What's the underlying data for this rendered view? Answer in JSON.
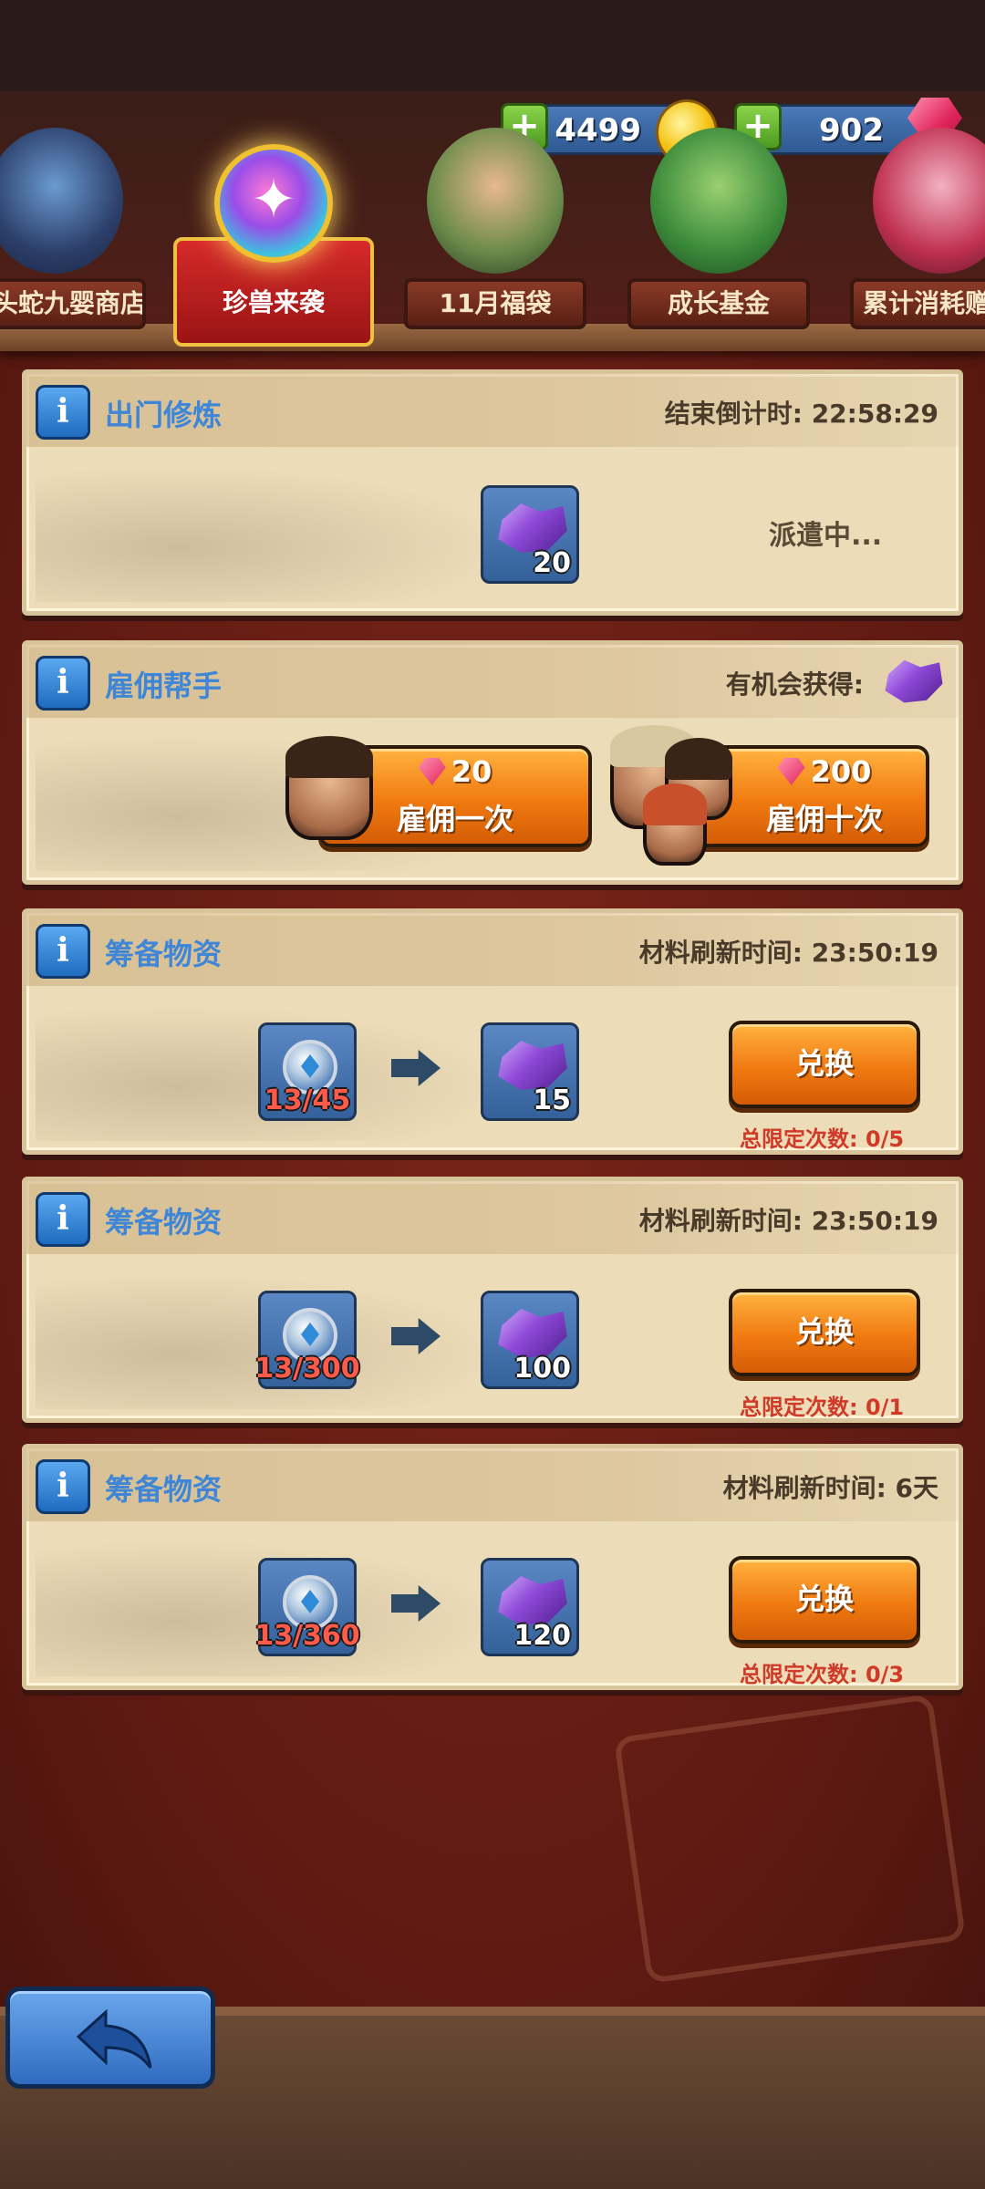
{
  "currency": {
    "gold": "4499",
    "gems": "902"
  },
  "tabs": [
    {
      "label": "九头蛇九婴商店"
    },
    {
      "label": "珍兽来袭"
    },
    {
      "label": "11月福袋"
    },
    {
      "label": "成长基金"
    },
    {
      "label": "累计消耗赠送"
    }
  ],
  "panels": {
    "dispatch": {
      "title": "出门修炼",
      "right": "结束倒计时: 22:58:29",
      "reward_qty": "20",
      "status": "派遣中..."
    },
    "hire": {
      "title": "雇佣帮手",
      "right": "有机会获得:",
      "once_cost": "20",
      "once_label": "雇佣一次",
      "ten_cost": "200",
      "ten_label": "雇佣十次"
    },
    "exchanges": [
      {
        "title": "筹备物资",
        "right": "材料刷新时间: 23:50:19",
        "req": "13/45",
        "reward_qty": "15",
        "button": "兑换",
        "limit": "总限定次数: 0/5"
      },
      {
        "title": "筹备物资",
        "right": "材料刷新时间: 23:50:19",
        "req": "13/300",
        "reward_qty": "100",
        "button": "兑换",
        "limit": "总限定次数: 0/1"
      },
      {
        "title": "筹备物资",
        "right": "材料刷新时间: 6天",
        "req": "13/360",
        "reward_qty": "120",
        "button": "兑换",
        "limit": "总限定次数: 0/3"
      }
    ]
  },
  "icons": {
    "info": "i",
    "tab_active_emblem": "✦"
  }
}
